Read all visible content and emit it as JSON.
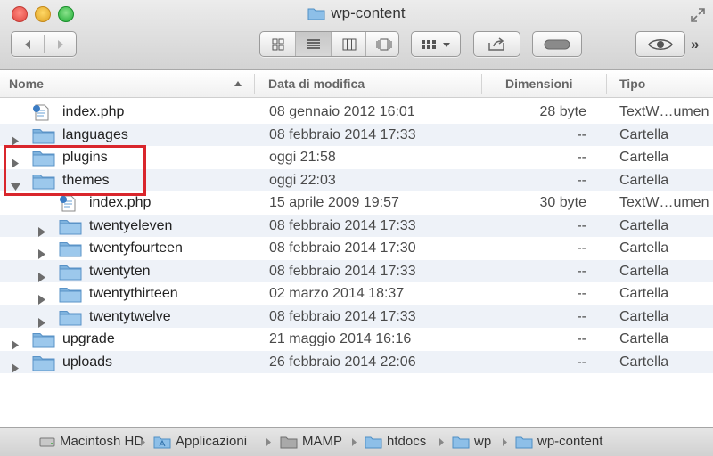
{
  "window": {
    "title": "wp-content"
  },
  "toolbar": {
    "back": "back-arrow",
    "forward": "forward-arrow",
    "view_modes": [
      "icon-view",
      "list-view",
      "column-view",
      "coverflow-view"
    ],
    "active_view": "list-view",
    "arrange": "arrange-menu",
    "share": "share",
    "tags": "tags",
    "quicklook": "quick-look",
    "more": "»"
  },
  "columns": {
    "name": "Nome",
    "date": "Data di modifica",
    "size": "Dimensioni",
    "kind": "Tipo"
  },
  "files": [
    {
      "name": "index.php",
      "date": "08 gennaio 2012 16:01",
      "size": "28 byte",
      "kind": "TextW…umen",
      "type": "php",
      "level": 0,
      "expander": "none"
    },
    {
      "name": "languages",
      "date": "08 febbraio 2014 17:33",
      "size": "--",
      "kind": "Cartella",
      "type": "folder",
      "level": 0,
      "expander": "closed"
    },
    {
      "name": "plugins",
      "date": "oggi 21:58",
      "size": "--",
      "kind": "Cartella",
      "type": "folder",
      "level": 0,
      "expander": "closed"
    },
    {
      "name": "themes",
      "date": "oggi 22:03",
      "size": "--",
      "kind": "Cartella",
      "type": "folder",
      "level": 0,
      "expander": "open"
    },
    {
      "name": "index.php",
      "date": "15 aprile 2009 19:57",
      "size": "30 byte",
      "kind": "TextW…umen",
      "type": "php",
      "level": 1,
      "expander": "none"
    },
    {
      "name": "twentyeleven",
      "date": "08 febbraio 2014 17:33",
      "size": "--",
      "kind": "Cartella",
      "type": "folder",
      "level": 1,
      "expander": "closed"
    },
    {
      "name": "twentyfourteen",
      "date": "08 febbraio 2014 17:30",
      "size": "--",
      "kind": "Cartella",
      "type": "folder",
      "level": 1,
      "expander": "closed"
    },
    {
      "name": "twentyten",
      "date": "08 febbraio 2014 17:33",
      "size": "--",
      "kind": "Cartella",
      "type": "folder",
      "level": 1,
      "expander": "closed"
    },
    {
      "name": "twentythirteen",
      "date": "02 marzo 2014 18:37",
      "size": "--",
      "kind": "Cartella",
      "type": "folder",
      "level": 1,
      "expander": "closed"
    },
    {
      "name": "twentytwelve",
      "date": "08 febbraio 2014 17:33",
      "size": "--",
      "kind": "Cartella",
      "type": "folder",
      "level": 1,
      "expander": "closed"
    },
    {
      "name": "upgrade",
      "date": "21 maggio 2014 16:16",
      "size": "--",
      "kind": "Cartella",
      "type": "folder",
      "level": 0,
      "expander": "closed"
    },
    {
      "name": "uploads",
      "date": "26 febbraio 2014 22:06",
      "size": "--",
      "kind": "Cartella",
      "type": "folder",
      "level": 0,
      "expander": "closed"
    }
  ],
  "pathbar": [
    {
      "label": "Macintosh HD",
      "icon": "hard-disk-icon"
    },
    {
      "label": "Applicazioni",
      "icon": "applications-folder-icon"
    },
    {
      "label": "MAMP",
      "icon": "mamp-folder-icon"
    },
    {
      "label": "htdocs",
      "icon": "folder-icon"
    },
    {
      "label": "wp",
      "icon": "folder-icon"
    },
    {
      "label": "wp-content",
      "icon": "folder-icon"
    }
  ],
  "colors": {
    "folder": "#7fb3de",
    "alt_row": "#eef2f8",
    "highlight": "#d9262c"
  }
}
